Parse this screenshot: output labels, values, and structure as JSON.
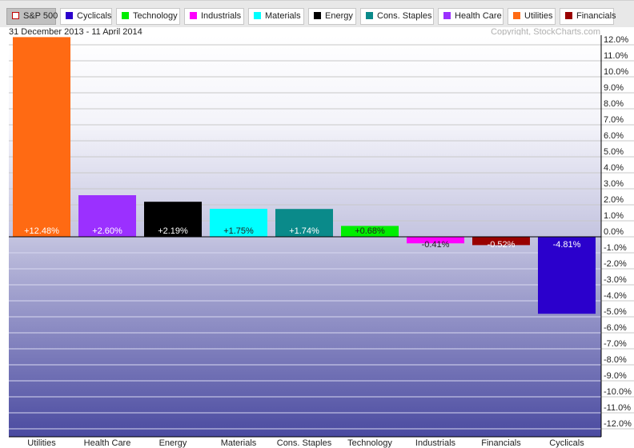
{
  "toolbar": {
    "buttons": [
      {
        "label": "S&P 500",
        "color": "#ffffff",
        "active": true
      },
      {
        "label": "Cyclicals",
        "color": "#2b00cc"
      },
      {
        "label": "Technology",
        "color": "#00ee00"
      },
      {
        "label": "Industrials",
        "color": "#ff00ff"
      },
      {
        "label": "Materials",
        "color": "#00ffff"
      },
      {
        "label": "Energy",
        "color": "#000000"
      },
      {
        "label": "Cons. Staples",
        "color": "#0a8a8a"
      },
      {
        "label": "Health Care",
        "color": "#9b30ff"
      },
      {
        "label": "Utilities",
        "color": "#ff6a13"
      },
      {
        "label": "Financials",
        "color": "#990000"
      }
    ]
  },
  "header": {
    "date_range": "31 December 2013 - 11 April 2014",
    "copyright": "Copyright, StockCharts.com"
  },
  "chart_data": {
    "type": "bar",
    "title": "31 December 2013 - 11 April 2014",
    "xlabel": "",
    "ylabel": "",
    "ylim": [
      -12.5,
      12.5
    ],
    "grid": true,
    "y_axis_position": "right",
    "categories": [
      "Utilities",
      "Health Care",
      "Energy",
      "Materials",
      "Cons. Staples",
      "Technology",
      "Industrials",
      "Financials",
      "Cyclicals"
    ],
    "values": [
      12.48,
      2.6,
      2.19,
      1.75,
      1.74,
      0.68,
      -0.41,
      -0.52,
      -4.81
    ],
    "value_labels": [
      "+12.48%",
      "+2.60%",
      "+2.19%",
      "+1.75%",
      "+1.74%",
      "+0.68%",
      "-0.41%",
      "-0.52%",
      "-4.81%"
    ],
    "colors": [
      "#ff6a13",
      "#9b30ff",
      "#000000",
      "#00ffff",
      "#0a8a8a",
      "#00ee00",
      "#ff00ff",
      "#990000",
      "#2b00cc"
    ],
    "label_colors": [
      "#ffffff",
      "#ffffff",
      "#ffffff",
      "#222222",
      "#ffffff",
      "#222222",
      "#222222",
      "#ffffff",
      "#ffffff"
    ],
    "yticks": [
      12,
      11,
      10,
      9,
      8,
      7,
      6,
      5,
      4,
      3,
      2,
      1,
      0,
      -1,
      -2,
      -3,
      -4,
      -5,
      -6,
      -7,
      -8,
      -9,
      -10,
      -11,
      -12
    ],
    "ytick_labels": [
      "12.0%",
      "11.0%",
      "10.0%",
      "9.0%",
      "8.0%",
      "7.0%",
      "6.0%",
      "5.0%",
      "4.0%",
      "3.0%",
      "2.0%",
      "1.0%",
      "0.0%",
      "-1.0%",
      "-2.0%",
      "-3.0%",
      "-4.0%",
      "-5.0%",
      "-6.0%",
      "-7.0%",
      "-8.0%",
      "-9.0%",
      "-10.0%",
      "-11.0%",
      "-12.0%"
    ]
  }
}
